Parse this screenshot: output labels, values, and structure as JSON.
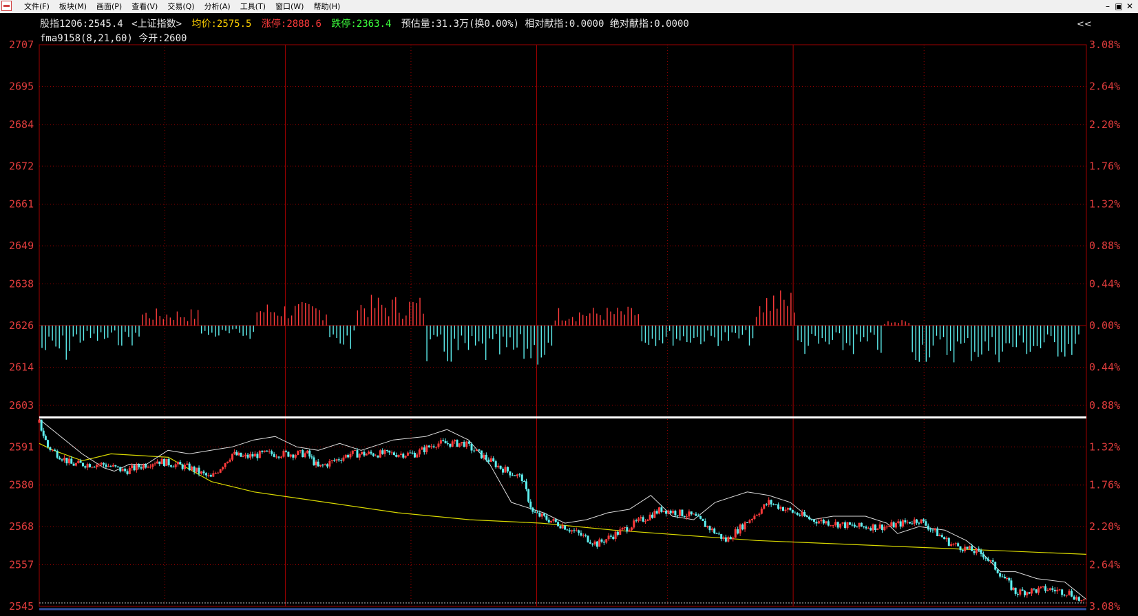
{
  "menubar": {
    "items": [
      "文件(F)",
      "板块(M)",
      "画面(P)",
      "查看(V)",
      "交易(Q)",
      "分析(A)",
      "工具(T)",
      "窗口(W)",
      "帮助(H)"
    ]
  },
  "window_controls": {
    "minimize": "–",
    "restore": "▣",
    "close": "✕"
  },
  "info_bar": {
    "title": "股指1206:2545.4",
    "index_name": "<上证指数>",
    "avg_label": "均价:",
    "avg_value": "2575.5",
    "limit_up_label": "涨停:",
    "limit_up_value": "2888.6",
    "limit_down_label": "跌停:",
    "limit_down_value": "2363.4",
    "rest": "预估量:31.3万(换0.00%) 相对献指:0.0000 绝对献指:0.0000",
    "line2": "fma9158(8,21,60)  今开:2600",
    "collapse": "<<"
  },
  "colors": {
    "background": "#000000",
    "grid": "#a00000",
    "axis_text": "#e03c3c",
    "up": "#ff3b3b",
    "down": "#5ef0f0",
    "avg_line": "#d8d800",
    "fma_line": "#ffffff",
    "white_text": "#e8e8e8",
    "yellow_text": "#ffd000",
    "green_text": "#3cff3c"
  },
  "chart_data": {
    "type": "line",
    "y_axis_left": [
      2707,
      2695,
      2684,
      2672,
      2661,
      2649,
      2638,
      2626,
      2614,
      2603,
      2591,
      2580,
      2568,
      2557,
      2545
    ],
    "y_axis_right": [
      "3.08%",
      "2.64%",
      "2.20%",
      "1.76%",
      "1.32%",
      "0.88%",
      "0.44%",
      "0.00%",
      "0.44%",
      "0.88%",
      "1.32%",
      "1.76%",
      "2.20%",
      "2.64%",
      "3.08%"
    ],
    "ylim": [
      2545,
      2707
    ],
    "prev_close": 2626,
    "open_price": 2600,
    "last_price": 2545.4,
    "minutes": 270,
    "price_path": [
      [
        0,
        2598
      ],
      [
        4,
        2591
      ],
      [
        15,
        2586
      ],
      [
        30,
        2586
      ],
      [
        40,
        2584
      ],
      [
        55,
        2587
      ],
      [
        70,
        2585
      ],
      [
        80,
        2582
      ],
      [
        90,
        2589
      ],
      [
        95,
        2588
      ],
      [
        105,
        2589
      ],
      [
        125,
        2589
      ],
      [
        130,
        2585
      ],
      [
        145,
        2589
      ],
      [
        160,
        2589
      ],
      [
        175,
        2589
      ],
      [
        185,
        2592
      ],
      [
        198,
        2592
      ],
      [
        205,
        2589
      ],
      [
        215,
        2585
      ],
      [
        225,
        2582
      ],
      [
        230,
        2572
      ],
      [
        245,
        2568
      ],
      [
        260,
        2563
      ],
      [
        275,
        2568
      ],
      [
        290,
        2573
      ],
      [
        305,
        2571
      ],
      [
        320,
        2564
      ],
      [
        340,
        2575
      ],
      [
        360,
        2570
      ],
      [
        380,
        2568
      ],
      [
        395,
        2568
      ],
      [
        410,
        2570
      ],
      [
        425,
        2563
      ],
      [
        440,
        2560
      ],
      [
        450,
        2553
      ],
      [
        455,
        2549
      ],
      [
        470,
        2550
      ],
      [
        480,
        2549
      ],
      [
        488,
        2545.4
      ]
    ],
    "fma_path": [
      [
        0,
        2599
      ],
      [
        20,
        2589
      ],
      [
        30,
        2585
      ],
      [
        35,
        2584
      ],
      [
        42,
        2586
      ],
      [
        50,
        2586
      ],
      [
        60,
        2590
      ],
      [
        70,
        2589
      ],
      [
        80,
        2590
      ],
      [
        90,
        2591
      ],
      [
        100,
        2593
      ],
      [
        110,
        2594
      ],
      [
        120,
        2591
      ],
      [
        130,
        2590
      ],
      [
        140,
        2592
      ],
      [
        150,
        2590
      ],
      [
        165,
        2593
      ],
      [
        180,
        2594
      ],
      [
        190,
        2596
      ],
      [
        200,
        2593
      ],
      [
        210,
        2586
      ],
      [
        220,
        2575
      ],
      [
        235,
        2572
      ],
      [
        245,
        2569
      ],
      [
        255,
        2570
      ],
      [
        265,
        2572
      ],
      [
        275,
        2573
      ],
      [
        285,
        2577
      ],
      [
        295,
        2571
      ],
      [
        305,
        2570
      ],
      [
        315,
        2575
      ],
      [
        330,
        2578
      ],
      [
        340,
        2577
      ],
      [
        350,
        2575
      ],
      [
        360,
        2570
      ],
      [
        370,
        2571
      ],
      [
        385,
        2571
      ],
      [
        395,
        2569
      ],
      [
        400,
        2566
      ],
      [
        410,
        2568
      ],
      [
        422,
        2567
      ],
      [
        432,
        2564
      ],
      [
        440,
        2560
      ],
      [
        448,
        2555
      ],
      [
        455,
        2555
      ],
      [
        465,
        2553
      ],
      [
        478,
        2552
      ],
      [
        488,
        2547
      ]
    ],
    "avg_path": [
      [
        0,
        2592
      ],
      [
        20,
        2590
      ],
      [
        60,
        2587
      ],
      [
        100,
        2589
      ],
      [
        180,
        2588
      ],
      [
        240,
        2581
      ],
      [
        300,
        2578
      ],
      [
        400,
        2575
      ],
      [
        500,
        2572
      ],
      [
        600,
        2570
      ],
      [
        700,
        2569
      ],
      [
        800,
        2567
      ],
      [
        1000,
        2564
      ],
      [
        1460,
        2560
      ]
    ],
    "volume_bars_note": "contribution histogram around 2626 baseline",
    "support_line": 2599.5,
    "support_line_xrange": [
      0,
      488
    ],
    "vline_minutes": [
      120,
      240,
      360
    ]
  }
}
